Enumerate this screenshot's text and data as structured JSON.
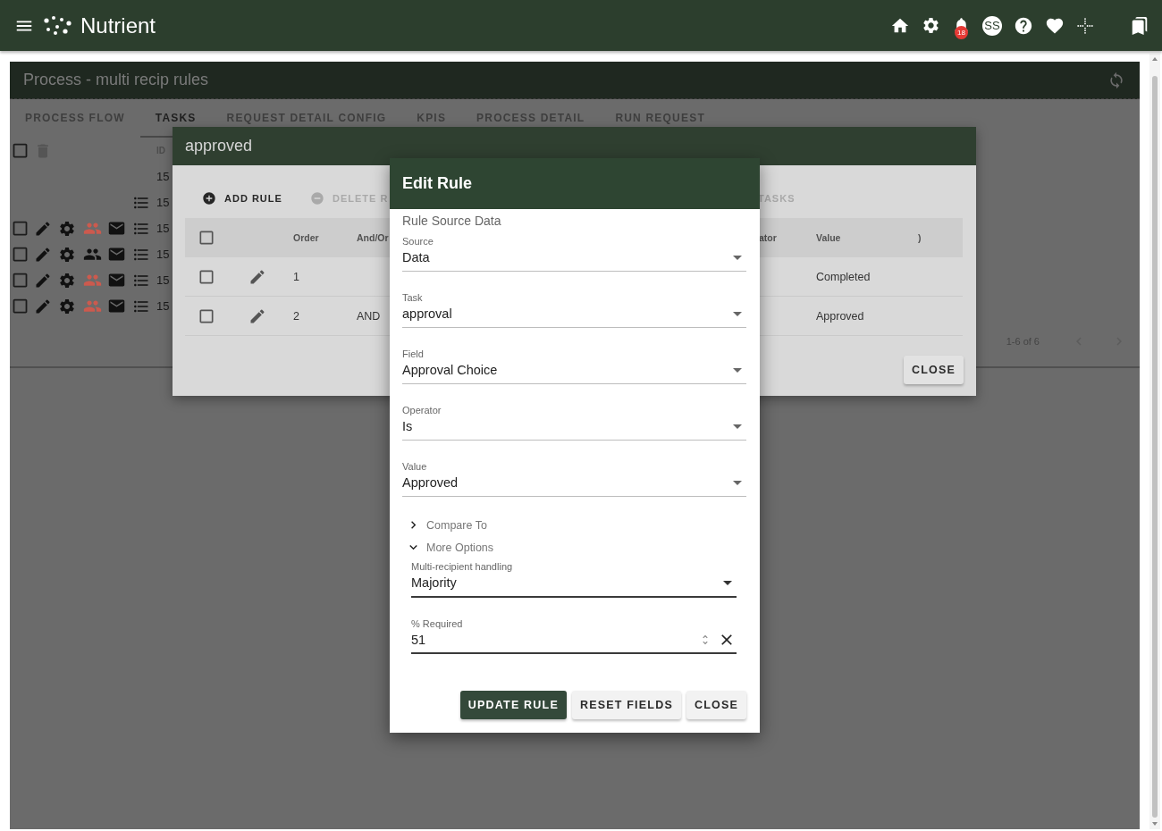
{
  "app_bar": {
    "brand": "Nutrient",
    "notification_count": "18",
    "avatar": "SS"
  },
  "process": {
    "title": "Process - multi recip rules",
    "tabs": [
      {
        "label": "PROCESS FLOW",
        "selected": false
      },
      {
        "label": "TASKS",
        "selected": true
      },
      {
        "label": "REQUEST DETAIL CONFIG",
        "selected": false
      },
      {
        "label": "KPIS",
        "selected": false
      },
      {
        "label": "PROCESS DETAIL",
        "selected": false
      },
      {
        "label": "RUN REQUEST",
        "selected": false
      }
    ],
    "table": {
      "id_heading": "ID",
      "select_all_checked": false,
      "rows": [
        {
          "kind": "id_only",
          "id": "15"
        },
        {
          "kind": "list",
          "id": "15"
        },
        {
          "kind": "actions",
          "id": "15",
          "checked": false,
          "color": "#cc5a4e"
        },
        {
          "kind": "actions",
          "id": "15",
          "checked": false,
          "color": "#111111"
        },
        {
          "kind": "actions",
          "id": "15",
          "checked": false,
          "color": "#cc5a4e"
        },
        {
          "kind": "actions",
          "id": "15",
          "checked": false,
          "color": "#cc5a4e"
        }
      ]
    },
    "pagination": "1-6 of 6"
  },
  "rules_dialog": {
    "title": "approved",
    "toolbar": [
      {
        "kind": "add",
        "label": "ADD RULE",
        "disabled": false
      },
      {
        "kind": "delete",
        "label": "DELETE R",
        "disabled": true
      },
      {
        "kind": "text",
        "label": "TASKS",
        "disabled": true
      }
    ],
    "select_all_checked": false,
    "columns": [
      "Order",
      "And/Or",
      "ator",
      "Value",
      ")"
    ],
    "rows": [
      {
        "order": "1",
        "value": "Completed",
        "checked": false
      },
      {
        "order": "2",
        "and_or": "AND",
        "value": "Approved",
        "checked": false
      }
    ],
    "close": "CLOSE"
  },
  "edit_rule": {
    "title": "Edit Rule",
    "section": "Rule Source Data",
    "fields": [
      {
        "label": "Source",
        "value": "Data"
      },
      {
        "label": "Task",
        "value": "approval"
      },
      {
        "label": "Field",
        "value": "Approval Choice"
      },
      {
        "label": "Operator",
        "value": "Is"
      },
      {
        "label": "Value",
        "value": "Approved"
      }
    ],
    "sections": [
      {
        "label": "Compare To",
        "expanded": false
      },
      {
        "label": "More Options",
        "expanded": true
      }
    ],
    "options": [
      {
        "kind": "select",
        "label": "Multi-recipient handling",
        "value": "Majority"
      },
      {
        "kind": "number",
        "label": "% Required",
        "value": "51"
      }
    ],
    "buttons": [
      {
        "label": "UPDATE RULE",
        "primary": true
      },
      {
        "label": "RESET FIELDS",
        "primary": false
      },
      {
        "label": "CLOSE",
        "primary": false
      }
    ]
  }
}
